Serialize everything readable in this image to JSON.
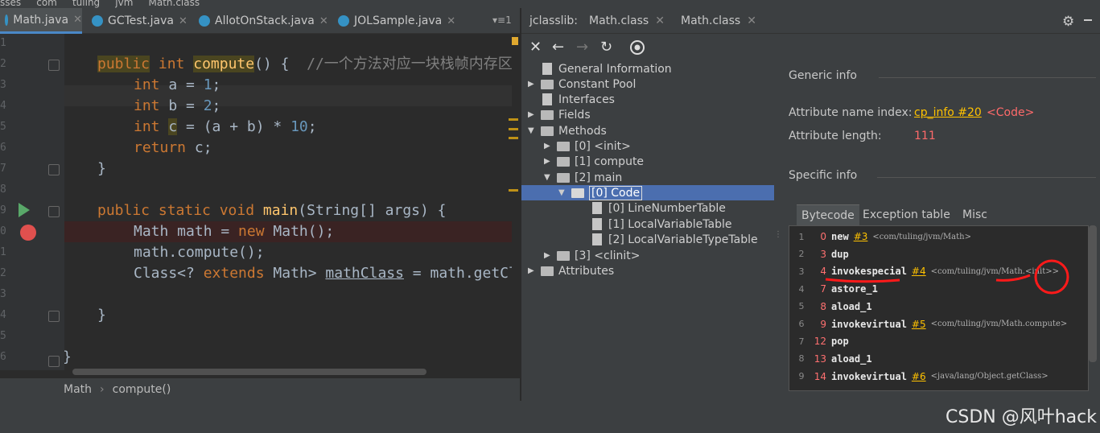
{
  "breadcrumb_top": [
    "sses",
    "com",
    "tuling",
    "jvm",
    "Math.class"
  ],
  "editor": {
    "tabs": [
      {
        "label": "Math.java",
        "active": true
      },
      {
        "label": "GCTest.java",
        "active": false
      },
      {
        "label": "AllotOnStack.java",
        "active": false
      },
      {
        "label": "JOLSample.java",
        "active": false
      }
    ],
    "tab_more": "▾≡1",
    "line_numbers": [
      "1",
      "2",
      "3",
      "4",
      "5",
      "6",
      "7",
      "8",
      "9",
      "0",
      "1",
      "2",
      "3",
      "4",
      "5",
      "6"
    ],
    "breadcrumb": {
      "class": "Math",
      "method": "compute()"
    }
  },
  "jclasslib": {
    "title": "jclasslib:",
    "tabs": [
      {
        "label": "Math.class"
      },
      {
        "label": "Math.class"
      }
    ],
    "tree": [
      {
        "label": "General Information",
        "depth": 0,
        "kind": "doc"
      },
      {
        "label": "Constant Pool",
        "depth": 0,
        "kind": "folder",
        "expanded": false
      },
      {
        "label": "Interfaces",
        "depth": 0,
        "kind": "doc"
      },
      {
        "label": "Fields",
        "depth": 0,
        "kind": "folder",
        "expanded": false
      },
      {
        "label": "Methods",
        "depth": 0,
        "kind": "folder",
        "expanded": true
      },
      {
        "label": "[0] <init>",
        "depth": 1,
        "kind": "folder",
        "expanded": false
      },
      {
        "label": "[1] compute",
        "depth": 1,
        "kind": "folder",
        "expanded": false
      },
      {
        "label": "[2] main",
        "depth": 1,
        "kind": "folder",
        "expanded": true
      },
      {
        "label": "[0] Code",
        "depth": 2,
        "kind": "folder",
        "expanded": true,
        "selected": true
      },
      {
        "label": "[0] LineNumberTable",
        "depth": 3,
        "kind": "doc"
      },
      {
        "label": "[1] LocalVariableTable",
        "depth": 3,
        "kind": "doc"
      },
      {
        "label": "[2] LocalVariableTypeTable",
        "depth": 3,
        "kind": "doc"
      },
      {
        "label": "[3] <clinit>",
        "depth": 1,
        "kind": "folder",
        "expanded": false
      },
      {
        "label": "Attributes",
        "depth": 0,
        "kind": "folder",
        "expanded": false
      }
    ],
    "generic_info": {
      "heading": "Generic info",
      "name_index_label": "Attribute name index:",
      "name_index_link": "cp_info #20",
      "name_index_value": "<Code>",
      "length_label": "Attribute length:",
      "length_value": "111"
    },
    "specific_info": {
      "heading": "Specific info",
      "tabs": [
        "Bytecode",
        "Exception table",
        "Misc"
      ],
      "bytecode": [
        {
          "n": "1",
          "off": "0",
          "op": "new",
          "ref": "#3",
          "comment": "<com/tuling/jvm/Math>"
        },
        {
          "n": "2",
          "off": "3",
          "op": "dup",
          "ref": "",
          "comment": ""
        },
        {
          "n": "3",
          "off": "4",
          "op": "invokespecial",
          "ref": "#4",
          "comment": "<com/tuling/jvm/Math.<init>>"
        },
        {
          "n": "4",
          "off": "7",
          "op": "astore_1",
          "ref": "",
          "comment": ""
        },
        {
          "n": "5",
          "off": "8",
          "op": "aload_1",
          "ref": "",
          "comment": ""
        },
        {
          "n": "6",
          "off": "9",
          "op": "invokevirtual",
          "ref": "#5",
          "comment": "<com/tuling/jvm/Math.compute>"
        },
        {
          "n": "7",
          "off": "12",
          "op": "pop",
          "ref": "",
          "comment": ""
        },
        {
          "n": "8",
          "off": "13",
          "op": "aload_1",
          "ref": "",
          "comment": ""
        },
        {
          "n": "9",
          "off": "14",
          "op": "invokevirtual",
          "ref": "#6",
          "comment": "<java/lang/Object.getClass>"
        }
      ]
    }
  },
  "watermark": "CSDN @风叶hack",
  "colors": {
    "accent": "#4b6eaf",
    "keyword": "#cc7832",
    "function": "#ffc66d",
    "number": "#6897bb",
    "link": "#ffc200",
    "breakpoint": "#e0504e",
    "annotation_red": "#ff1a1a"
  }
}
